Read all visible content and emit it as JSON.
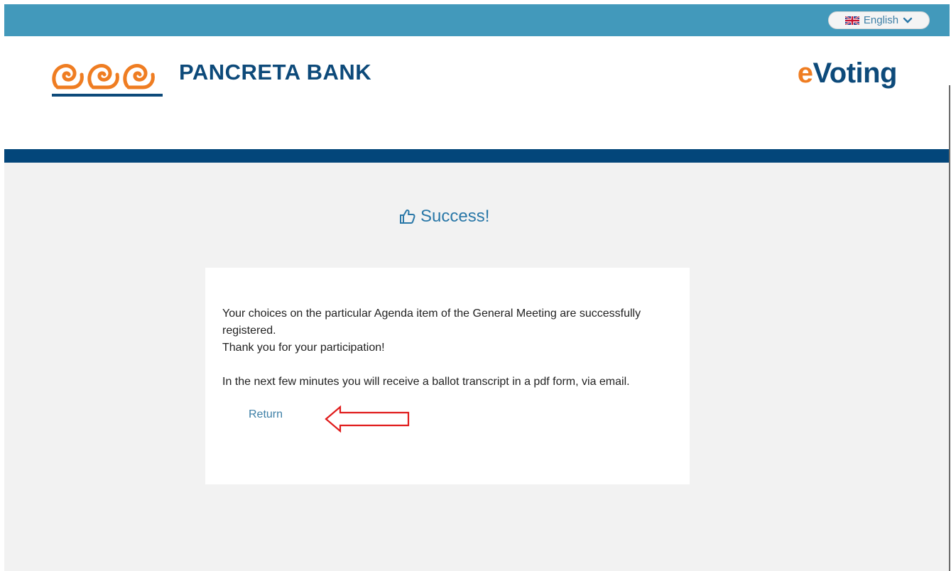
{
  "topbar": {
    "language": {
      "label": "English",
      "flag_icon": "uk-flag-icon",
      "chevron_icon": "chevron-down-icon"
    }
  },
  "header": {
    "bank_name": "PANCRETA BANK",
    "product": {
      "prefix": "e",
      "rest": "Voting"
    }
  },
  "main": {
    "heading": "Success!",
    "heading_icon": "thumbs-up-icon",
    "message": {
      "line1": "Your choices on the particular Agenda item of the General Meeting are successfully registered.",
      "line2": "Thank you for your participation!",
      "line3": "In the next few minutes you will receive a ballot transcript in a pdf form, via email."
    },
    "return_link": "Return"
  },
  "colors": {
    "topbar": "#4299bb",
    "navband": "#03467a",
    "brand_blue": "#0d4a7a",
    "brand_orange": "#ef7d22",
    "link": "#3d7fa6",
    "annotation_red": "#e01b1b"
  }
}
